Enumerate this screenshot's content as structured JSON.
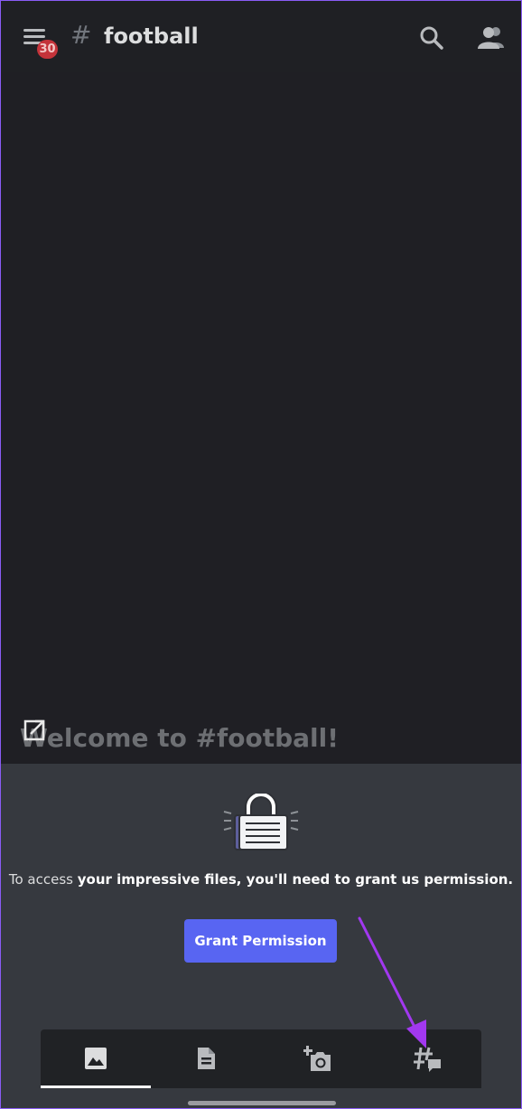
{
  "header": {
    "channel_hash": "#",
    "channel_name": "football",
    "notification_badge": "30"
  },
  "chat": {
    "welcome_text": "Welcome to #football!"
  },
  "permission": {
    "text_prefix": "To access ",
    "text_bold": "your impressive files, you'll need to grant us permission.",
    "button_label": "Grant Permission"
  },
  "tabs": [
    {
      "icon": "image-icon",
      "selected": true
    },
    {
      "icon": "document-icon",
      "selected": false
    },
    {
      "icon": "camera-add-icon",
      "selected": false
    },
    {
      "icon": "threads-icon",
      "selected": false
    }
  ],
  "colors": {
    "accent": "#5865f2",
    "badge": "#c4333a",
    "annotation_arrow": "#a238f0"
  }
}
